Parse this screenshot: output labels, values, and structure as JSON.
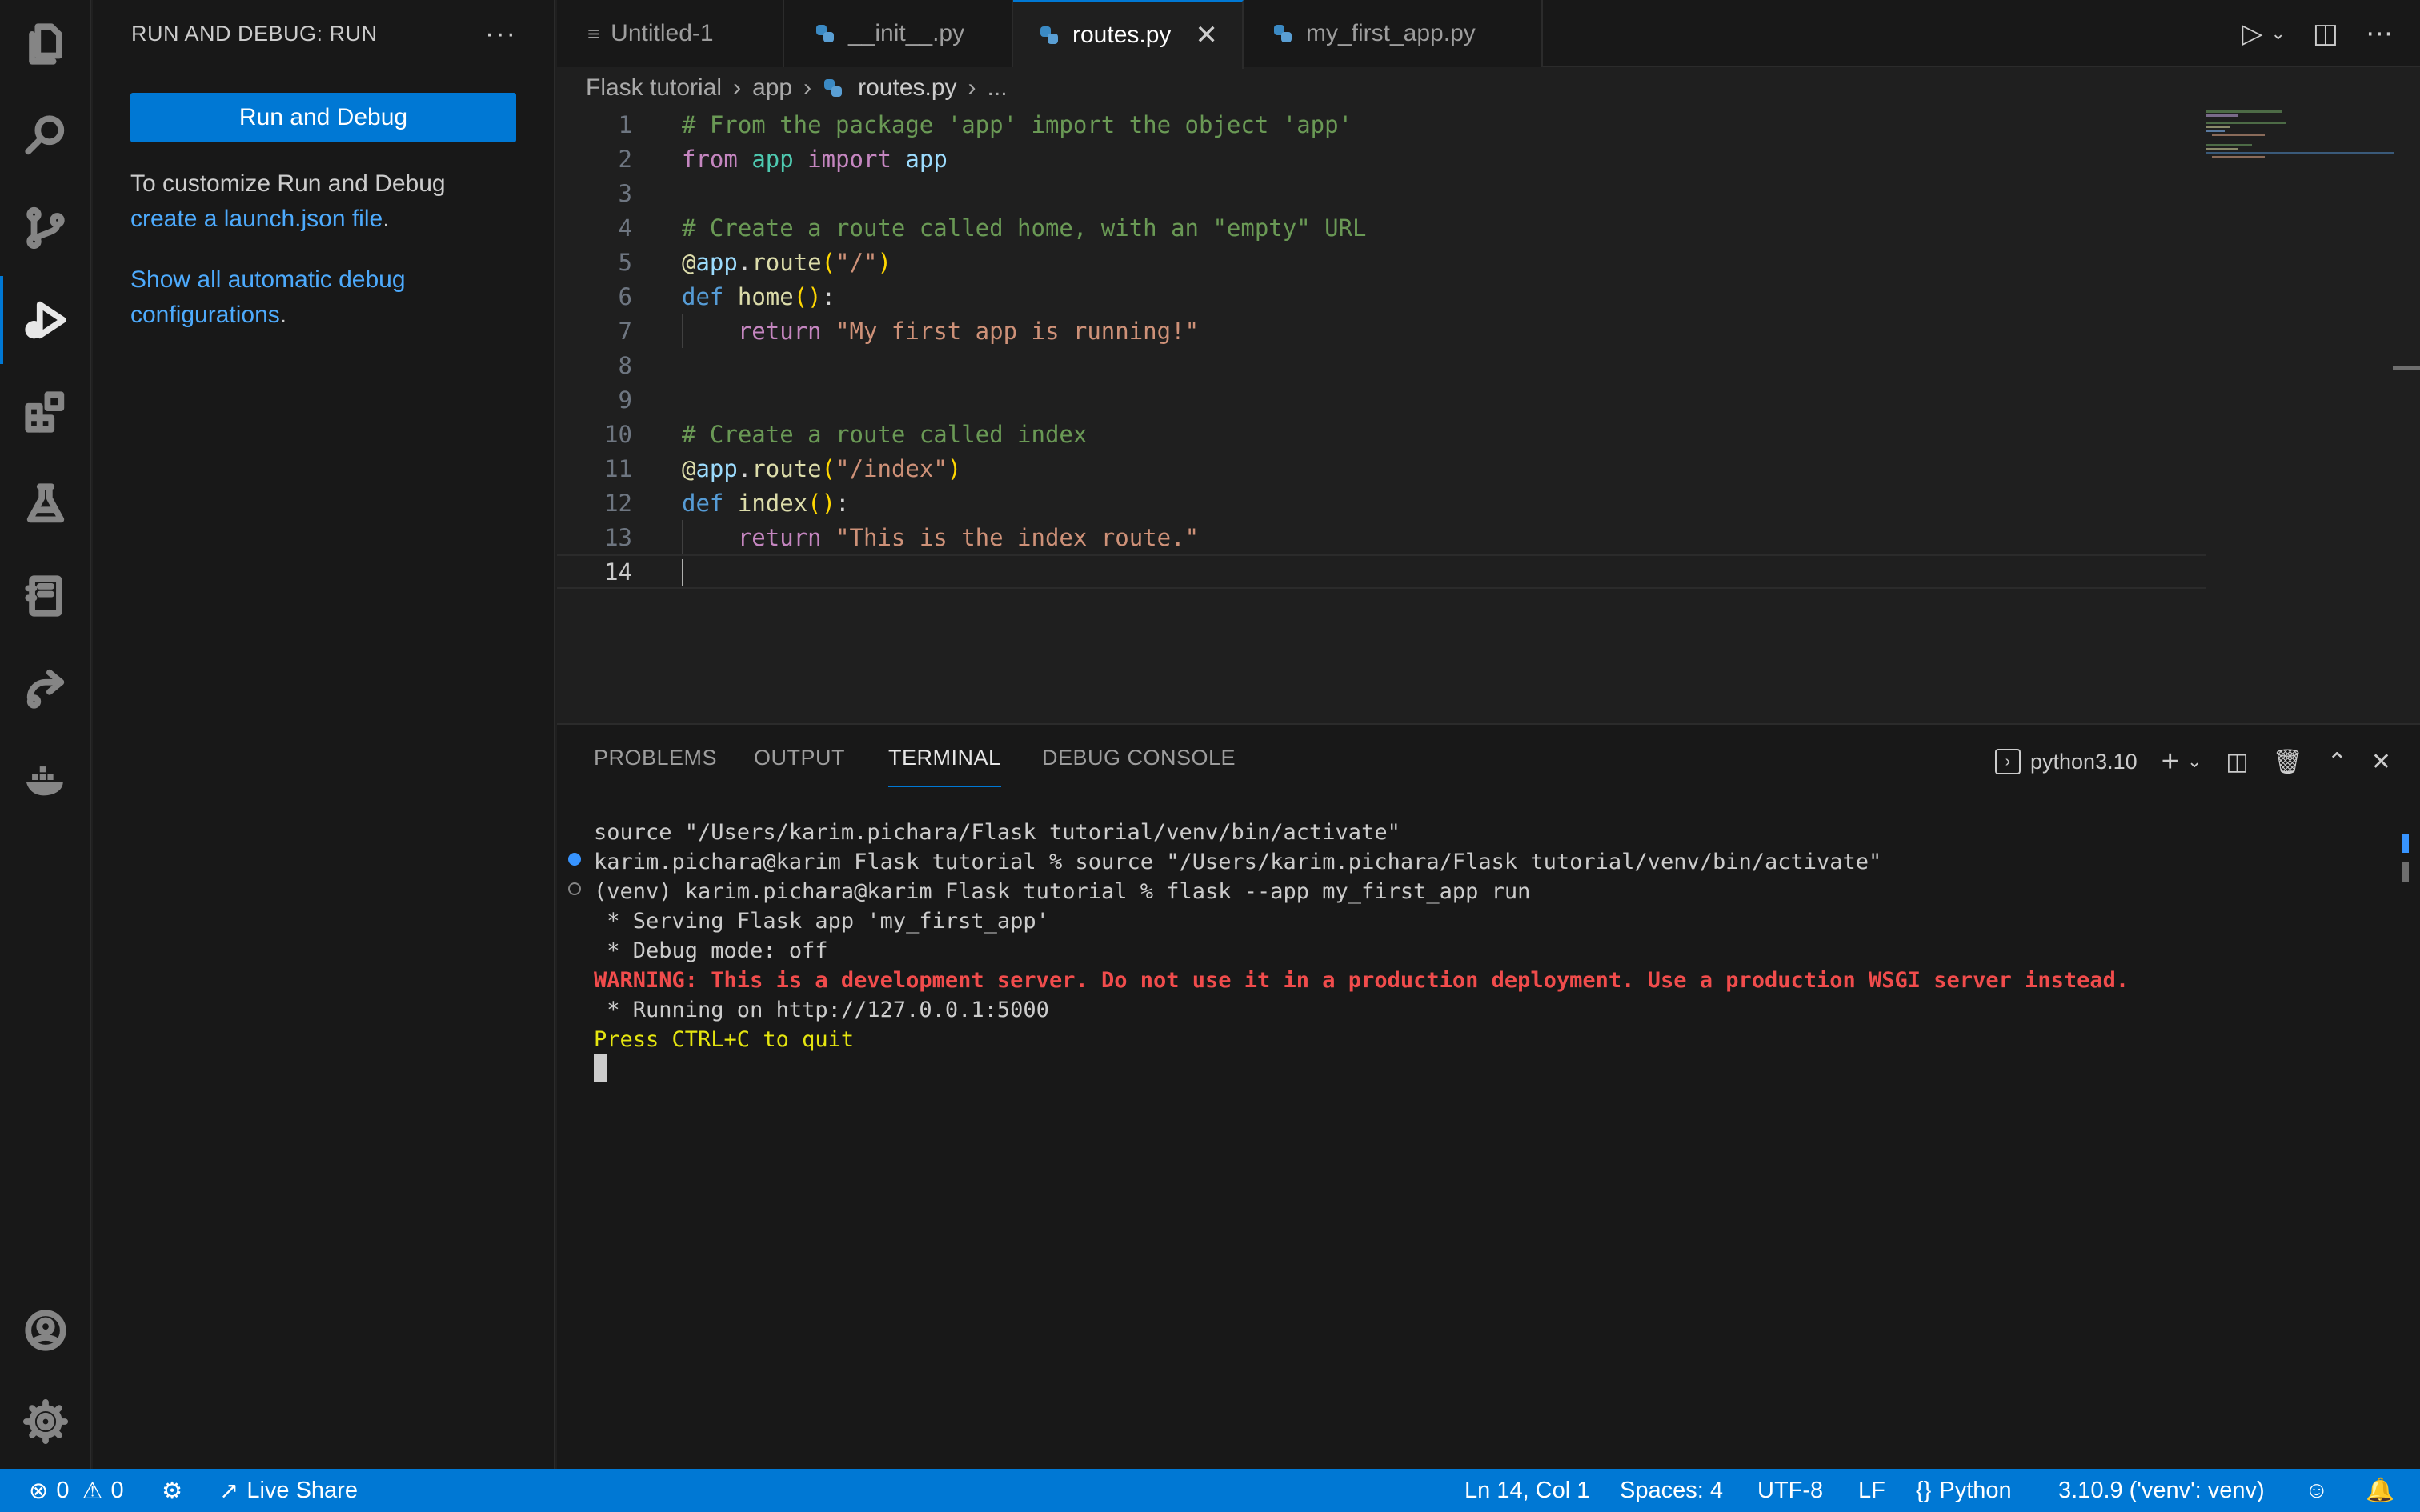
{
  "sidebar": {
    "title": "RUN AND DEBUG: RUN",
    "more": "···",
    "run_button": "Run and Debug",
    "customize_text": "To customize Run and Debug",
    "launch_link": "create a launch.json file",
    "period1": ".",
    "show_all_link": "Show all automatic debug configurations",
    "period2": "."
  },
  "tabs": [
    {
      "label": "Untitled-1",
      "icon": "lines-icon"
    },
    {
      "label": "__init__.py",
      "icon": "python-icon"
    },
    {
      "label": "routes.py",
      "icon": "python-icon",
      "active": true
    },
    {
      "label": "my_first_app.py",
      "icon": "python-icon"
    }
  ],
  "breadcrumb": {
    "folder": "Flask tutorial",
    "sub": "app",
    "file": "routes.py",
    "more": "..."
  },
  "editor": {
    "lines": [
      {
        "n": "1",
        "text": "# From the package 'app' import the object 'app'"
      },
      {
        "n": "2",
        "text": "from app import app"
      },
      {
        "n": "3",
        "text": ""
      },
      {
        "n": "4",
        "text": "# Create a route called home, with an \"empty\" URL"
      },
      {
        "n": "5",
        "text": "@app.route(\"/\")"
      },
      {
        "n": "6",
        "text": "def home():"
      },
      {
        "n": "7",
        "text": "    return \"My first app is running!\""
      },
      {
        "n": "8",
        "text": ""
      },
      {
        "n": "9",
        "text": ""
      },
      {
        "n": "10",
        "text": "# Create a route called index"
      },
      {
        "n": "11",
        "text": "@app.route(\"/index\")"
      },
      {
        "n": "12",
        "text": "def index():"
      },
      {
        "n": "13",
        "text": "    return \"This is the index route.\""
      },
      {
        "n": "14",
        "text": ""
      }
    ]
  },
  "panel": {
    "tabs": [
      "PROBLEMS",
      "OUTPUT",
      "TERMINAL",
      "DEBUG CONSOLE"
    ],
    "active_tab": "TERMINAL",
    "terminal_profile": "python3.10",
    "terminal_lines": [
      "source \"/Users/karim.pichara/Flask tutorial/venv/bin/activate\"",
      "karim.pichara@karim Flask tutorial % source \"/Users/karim.pichara/Flask tutorial/venv/bin/activate\"",
      "(venv) karim.pichara@karim Flask tutorial % flask --app my_first_app run",
      " * Serving Flask app 'my_first_app'",
      " * Debug mode: off",
      "WARNING: This is a development server. Do not use it in a production deployment. Use a production WSGI server instead.",
      " * Running on http://127.0.0.1:5000",
      "Press CTRL+C to quit"
    ]
  },
  "statusbar": {
    "errors": "0",
    "warnings": "0",
    "live_share": "Live Share",
    "position": "Ln 14, Col 1",
    "spaces": "Spaces: 4",
    "encoding": "UTF-8",
    "eol": "LF",
    "language": "Python",
    "interpreter": "3.10.9 ('venv': venv)"
  },
  "colors": {
    "accent": "#0078d4",
    "warning_text": "#f14c4c",
    "quit_text": "#e5e510"
  }
}
